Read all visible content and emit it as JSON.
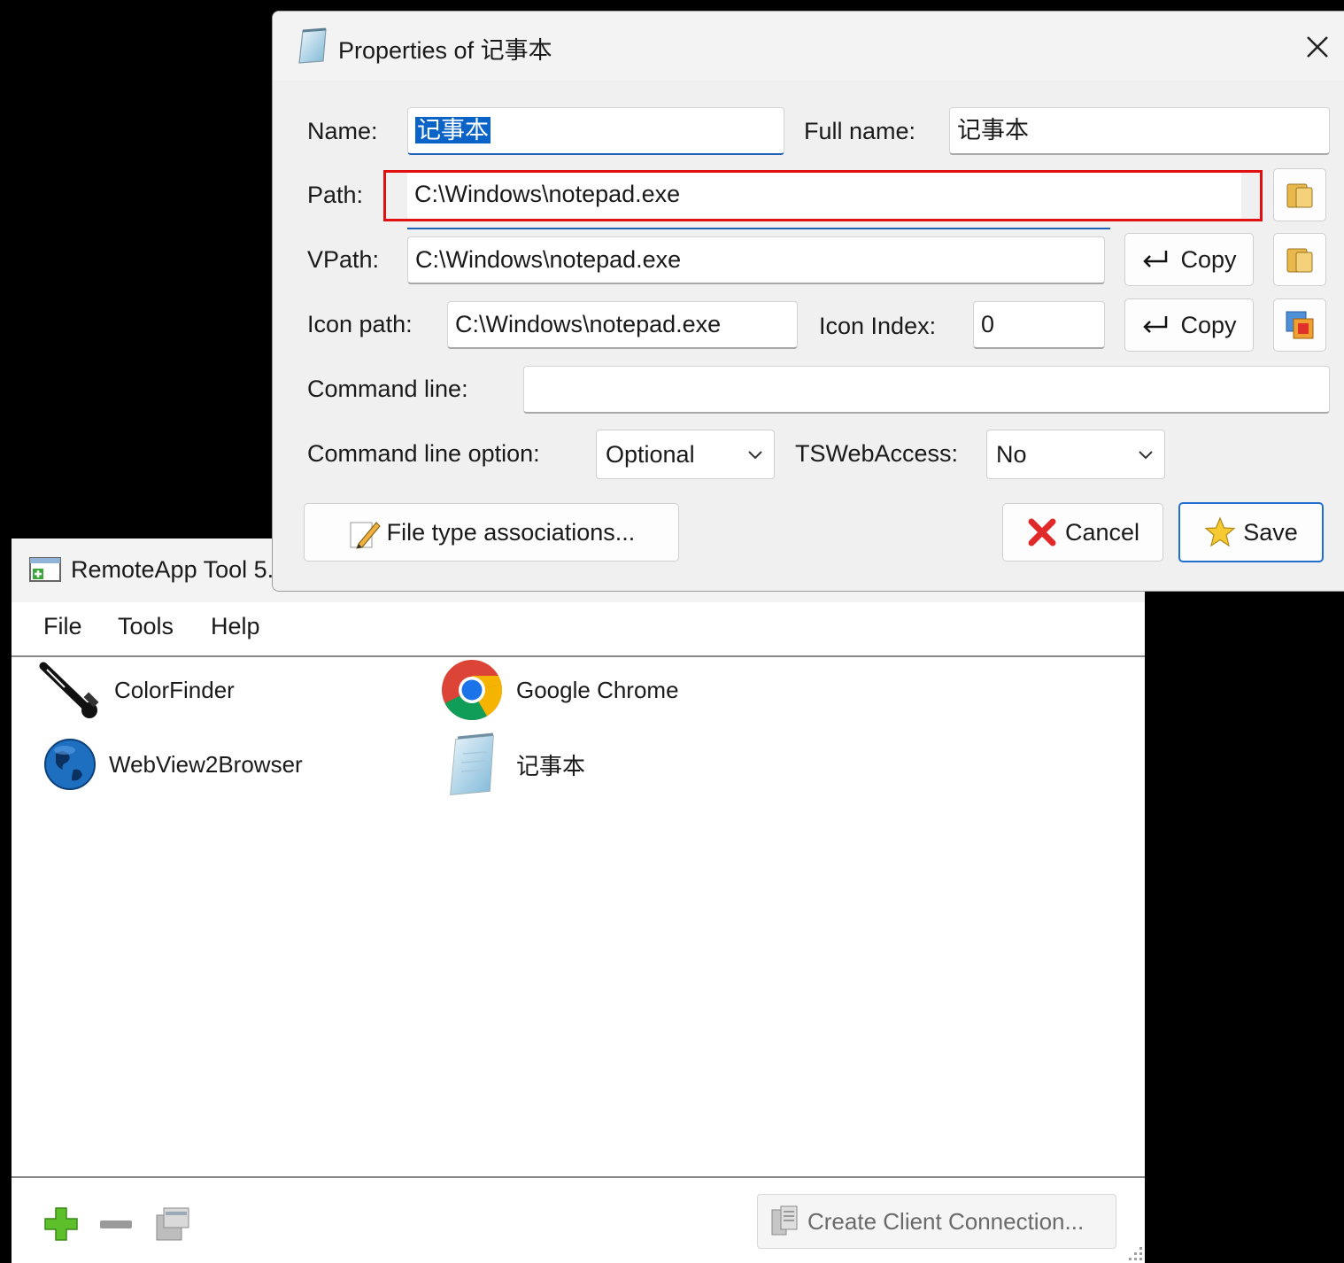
{
  "main_window": {
    "title": "RemoteApp Tool 5.",
    "menu": [
      "File",
      "Tools",
      "Help"
    ],
    "apps": [
      {
        "label": "ColorFinder",
        "icon": "eyedropper-icon"
      },
      {
        "label": "Google Chrome",
        "icon": "chrome-icon"
      },
      {
        "label": "WebView2Browser",
        "icon": "globe-icon"
      },
      {
        "label": "记事本",
        "icon": "notepad-icon"
      }
    ],
    "create_client_label": "Create Client Connection..."
  },
  "dialog": {
    "title": "Properties of 记事本",
    "name_label": "Name:",
    "name_value": "记事本",
    "full_name_label": "Full name:",
    "full_name_value": "记事本",
    "path_label": "Path:",
    "path_value": "C:\\Windows\\notepad.exe",
    "vpath_label": "VPath:",
    "vpath_value": "C:\\Windows\\notepad.exe",
    "copy_label": "Copy",
    "icon_path_label": "Icon path:",
    "icon_path_value": "C:\\Windows\\notepad.exe",
    "icon_index_label": "Icon Index:",
    "icon_index_value": "0",
    "command_line_label": "Command line:",
    "command_line_value": "",
    "command_line_option_label": "Command line option:",
    "command_line_option_value": "Optional",
    "tswebaccess_label": "TSWebAccess:",
    "tswebaccess_value": "No",
    "file_type_label": "File type associations...",
    "cancel_label": "Cancel",
    "save_label": "Save"
  },
  "colors": {
    "highlight_border": "#e01010",
    "focus_accent": "#1f5fb5",
    "selection": "#0a64c8"
  }
}
